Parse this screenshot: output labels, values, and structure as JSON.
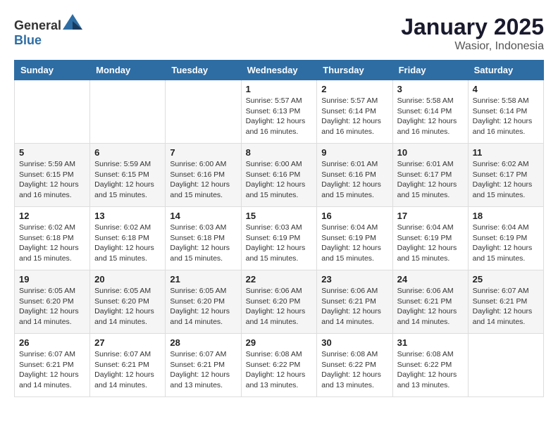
{
  "header": {
    "logo": {
      "general": "General",
      "blue": "Blue"
    },
    "title": "January 2025",
    "subtitle": "Wasior, Indonesia"
  },
  "calendar": {
    "weekdays": [
      "Sunday",
      "Monday",
      "Tuesday",
      "Wednesday",
      "Thursday",
      "Friday",
      "Saturday"
    ],
    "weeks": [
      [
        {
          "day": "",
          "sunrise": "",
          "sunset": "",
          "daylight": ""
        },
        {
          "day": "",
          "sunrise": "",
          "sunset": "",
          "daylight": ""
        },
        {
          "day": "",
          "sunrise": "",
          "sunset": "",
          "daylight": ""
        },
        {
          "day": "1",
          "sunrise": "Sunrise: 5:57 AM",
          "sunset": "Sunset: 6:13 PM",
          "daylight": "Daylight: 12 hours and 16 minutes."
        },
        {
          "day": "2",
          "sunrise": "Sunrise: 5:57 AM",
          "sunset": "Sunset: 6:14 PM",
          "daylight": "Daylight: 12 hours and 16 minutes."
        },
        {
          "day": "3",
          "sunrise": "Sunrise: 5:58 AM",
          "sunset": "Sunset: 6:14 PM",
          "daylight": "Daylight: 12 hours and 16 minutes."
        },
        {
          "day": "4",
          "sunrise": "Sunrise: 5:58 AM",
          "sunset": "Sunset: 6:14 PM",
          "daylight": "Daylight: 12 hours and 16 minutes."
        }
      ],
      [
        {
          "day": "5",
          "sunrise": "Sunrise: 5:59 AM",
          "sunset": "Sunset: 6:15 PM",
          "daylight": "Daylight: 12 hours and 16 minutes."
        },
        {
          "day": "6",
          "sunrise": "Sunrise: 5:59 AM",
          "sunset": "Sunset: 6:15 PM",
          "daylight": "Daylight: 12 hours and 15 minutes."
        },
        {
          "day": "7",
          "sunrise": "Sunrise: 6:00 AM",
          "sunset": "Sunset: 6:16 PM",
          "daylight": "Daylight: 12 hours and 15 minutes."
        },
        {
          "day": "8",
          "sunrise": "Sunrise: 6:00 AM",
          "sunset": "Sunset: 6:16 PM",
          "daylight": "Daylight: 12 hours and 15 minutes."
        },
        {
          "day": "9",
          "sunrise": "Sunrise: 6:01 AM",
          "sunset": "Sunset: 6:16 PM",
          "daylight": "Daylight: 12 hours and 15 minutes."
        },
        {
          "day": "10",
          "sunrise": "Sunrise: 6:01 AM",
          "sunset": "Sunset: 6:17 PM",
          "daylight": "Daylight: 12 hours and 15 minutes."
        },
        {
          "day": "11",
          "sunrise": "Sunrise: 6:02 AM",
          "sunset": "Sunset: 6:17 PM",
          "daylight": "Daylight: 12 hours and 15 minutes."
        }
      ],
      [
        {
          "day": "12",
          "sunrise": "Sunrise: 6:02 AM",
          "sunset": "Sunset: 6:18 PM",
          "daylight": "Daylight: 12 hours and 15 minutes."
        },
        {
          "day": "13",
          "sunrise": "Sunrise: 6:02 AM",
          "sunset": "Sunset: 6:18 PM",
          "daylight": "Daylight: 12 hours and 15 minutes."
        },
        {
          "day": "14",
          "sunrise": "Sunrise: 6:03 AM",
          "sunset": "Sunset: 6:18 PM",
          "daylight": "Daylight: 12 hours and 15 minutes."
        },
        {
          "day": "15",
          "sunrise": "Sunrise: 6:03 AM",
          "sunset": "Sunset: 6:19 PM",
          "daylight": "Daylight: 12 hours and 15 minutes."
        },
        {
          "day": "16",
          "sunrise": "Sunrise: 6:04 AM",
          "sunset": "Sunset: 6:19 PM",
          "daylight": "Daylight: 12 hours and 15 minutes."
        },
        {
          "day": "17",
          "sunrise": "Sunrise: 6:04 AM",
          "sunset": "Sunset: 6:19 PM",
          "daylight": "Daylight: 12 hours and 15 minutes."
        },
        {
          "day": "18",
          "sunrise": "Sunrise: 6:04 AM",
          "sunset": "Sunset: 6:19 PM",
          "daylight": "Daylight: 12 hours and 15 minutes."
        }
      ],
      [
        {
          "day": "19",
          "sunrise": "Sunrise: 6:05 AM",
          "sunset": "Sunset: 6:20 PM",
          "daylight": "Daylight: 12 hours and 14 minutes."
        },
        {
          "day": "20",
          "sunrise": "Sunrise: 6:05 AM",
          "sunset": "Sunset: 6:20 PM",
          "daylight": "Daylight: 12 hours and 14 minutes."
        },
        {
          "day": "21",
          "sunrise": "Sunrise: 6:05 AM",
          "sunset": "Sunset: 6:20 PM",
          "daylight": "Daylight: 12 hours and 14 minutes."
        },
        {
          "day": "22",
          "sunrise": "Sunrise: 6:06 AM",
          "sunset": "Sunset: 6:20 PM",
          "daylight": "Daylight: 12 hours and 14 minutes."
        },
        {
          "day": "23",
          "sunrise": "Sunrise: 6:06 AM",
          "sunset": "Sunset: 6:21 PM",
          "daylight": "Daylight: 12 hours and 14 minutes."
        },
        {
          "day": "24",
          "sunrise": "Sunrise: 6:06 AM",
          "sunset": "Sunset: 6:21 PM",
          "daylight": "Daylight: 12 hours and 14 minutes."
        },
        {
          "day": "25",
          "sunrise": "Sunrise: 6:07 AM",
          "sunset": "Sunset: 6:21 PM",
          "daylight": "Daylight: 12 hours and 14 minutes."
        }
      ],
      [
        {
          "day": "26",
          "sunrise": "Sunrise: 6:07 AM",
          "sunset": "Sunset: 6:21 PM",
          "daylight": "Daylight: 12 hours and 14 minutes."
        },
        {
          "day": "27",
          "sunrise": "Sunrise: 6:07 AM",
          "sunset": "Sunset: 6:21 PM",
          "daylight": "Daylight: 12 hours and 14 minutes."
        },
        {
          "day": "28",
          "sunrise": "Sunrise: 6:07 AM",
          "sunset": "Sunset: 6:21 PM",
          "daylight": "Daylight: 12 hours and 13 minutes."
        },
        {
          "day": "29",
          "sunrise": "Sunrise: 6:08 AM",
          "sunset": "Sunset: 6:22 PM",
          "daylight": "Daylight: 12 hours and 13 minutes."
        },
        {
          "day": "30",
          "sunrise": "Sunrise: 6:08 AM",
          "sunset": "Sunset: 6:22 PM",
          "daylight": "Daylight: 12 hours and 13 minutes."
        },
        {
          "day": "31",
          "sunrise": "Sunrise: 6:08 AM",
          "sunset": "Sunset: 6:22 PM",
          "daylight": "Daylight: 12 hours and 13 minutes."
        },
        {
          "day": "",
          "sunrise": "",
          "sunset": "",
          "daylight": ""
        }
      ]
    ]
  }
}
